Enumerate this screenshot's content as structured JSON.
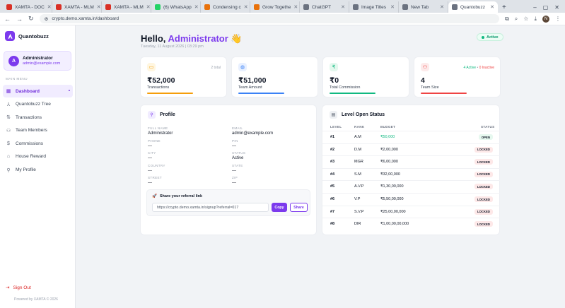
{
  "browser": {
    "tabs": [
      {
        "label": "XAMTA - DOC",
        "color": "#d93025"
      },
      {
        "label": "XAMTA - MLM",
        "color": "#d93025"
      },
      {
        "label": "XAMTA - MLM",
        "color": "#d93025"
      },
      {
        "label": "(6) WhatsApp",
        "color": "#25d366"
      },
      {
        "label": "Condensing c",
        "color": "#e8710a"
      },
      {
        "label": "Grow Togethe",
        "color": "#e8710a"
      },
      {
        "label": "ChatGPT",
        "color": "#6b7280"
      },
      {
        "label": "Image Titles",
        "color": "#6b7280"
      },
      {
        "label": "New Tab",
        "color": "#6b7280"
      },
      {
        "label": "Quantobuzz",
        "color": "#6b7280"
      }
    ],
    "url": "crypto.demo.xamta.in/dashboard",
    "profile_initial": "N"
  },
  "sidebar": {
    "brand": "Quantobuzz",
    "user": {
      "initial": "A",
      "name": "Administrator",
      "email": "admin@example.com"
    },
    "menu_heading": "MAIN MENU",
    "items": [
      {
        "label": "Dashboard",
        "icon": "grid-icon",
        "glyph": "▦"
      },
      {
        "label": "Quantobuzz Tree",
        "icon": "tree-icon",
        "glyph": "⅄"
      },
      {
        "label": "Transactions",
        "icon": "arrows-icon",
        "glyph": "⇅"
      },
      {
        "label": "Team Members",
        "icon": "users-icon",
        "glyph": "⚇"
      },
      {
        "label": "Commissions",
        "icon": "dollar-icon",
        "glyph": "$"
      },
      {
        "label": "House Reward",
        "icon": "home-icon",
        "glyph": "⌂"
      },
      {
        "label": "My Profile",
        "icon": "user-icon",
        "glyph": "⚲"
      }
    ],
    "signout": "Sign Out",
    "powered": "Powered by XAMTA © 2026"
  },
  "header": {
    "hello": "Hello,",
    "name": "Administrator",
    "wave": "👋",
    "date": "Tuesday, 11 August 2026 | 03:29 pm",
    "status": "Active"
  },
  "stats": [
    {
      "value": "₹52,000",
      "label": "Transactions",
      "meta": "2 total",
      "color": "#f59e0b",
      "bg": "#fff6e0",
      "glyph": "▭",
      "progress": 0.62
    },
    {
      "value": "₹51,000",
      "label": "Team Amount",
      "meta": "",
      "color": "#3b82f6",
      "bg": "#e8f0ff",
      "glyph": "◍",
      "progress": 0.62
    },
    {
      "value": "₹0",
      "label": "Total Commission",
      "meta": "",
      "color": "#10b981",
      "bg": "#e4f8ee",
      "glyph": "₹",
      "progress": 0.62
    },
    {
      "value": "4",
      "label": "Team Size",
      "meta_active": "4 Active",
      "meta_sep": "•",
      "meta_inactive": "0 Inactive",
      "color": "#ef4444",
      "bg": "#fdeaea",
      "glyph": "⚇",
      "progress": 0.62
    }
  ],
  "profile": {
    "title": "Profile",
    "fields": [
      {
        "label": "FULL NAME",
        "value": "Administrator"
      },
      {
        "label": "EMAIL",
        "value": "admin@example.com"
      },
      {
        "label": "PHONE",
        "value": "—"
      },
      {
        "label": "PIN",
        "value": "—"
      },
      {
        "label": "CITY",
        "value": "—"
      },
      {
        "label": "STATUS",
        "value": "Active"
      },
      {
        "label": "COUNTRY",
        "value": "—"
      },
      {
        "label": "STATE",
        "value": "—"
      },
      {
        "label": "STREET",
        "value": "—"
      },
      {
        "label": "ZIP",
        "value": "—"
      }
    ],
    "referral": {
      "title": "Share your referral link",
      "link": "https://crypto.demo.xamta.in/signup?referral=017",
      "copy": "Copy",
      "share": "Share"
    }
  },
  "levels": {
    "title": "Level Open Status",
    "headers": {
      "level": "LEVEL",
      "rank": "RANK",
      "budget": "BUDGET",
      "status": "STATUS"
    },
    "rows": [
      {
        "level": "#1",
        "rank": "A.M",
        "budget": "₹50,000",
        "status": "OPEN"
      },
      {
        "level": "#2",
        "rank": "D.M",
        "budget": "₹2,00,000",
        "status": "LOCKED"
      },
      {
        "level": "#3",
        "rank": "MGR",
        "budget": "₹6,00,000",
        "status": "LOCKED"
      },
      {
        "level": "#4",
        "rank": "S.M",
        "budget": "₹32,00,000",
        "status": "LOCKED"
      },
      {
        "level": "#5",
        "rank": "A.V.P",
        "budget": "₹1,30,00,000",
        "status": "LOCKED"
      },
      {
        "level": "#6",
        "rank": "V.P",
        "budget": "₹5,50,00,000",
        "status": "LOCKED"
      },
      {
        "level": "#7",
        "rank": "S.V.P",
        "budget": "₹25,00,00,000",
        "status": "LOCKED"
      },
      {
        "level": "#8",
        "rank": "DIR",
        "budget": "₹1,00,00,00,000",
        "status": "LOCKED"
      }
    ]
  }
}
